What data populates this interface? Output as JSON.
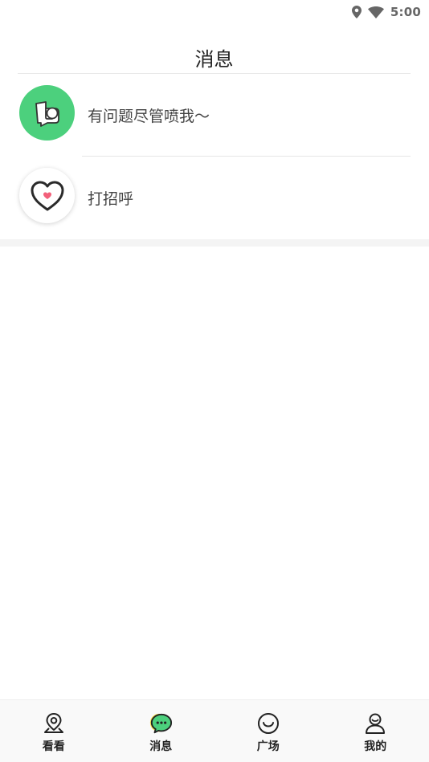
{
  "status_bar": {
    "time": "5:00",
    "icons": [
      "location-icon",
      "wifi-icon"
    ]
  },
  "header": {
    "title": "消息"
  },
  "conversations": [
    {
      "label": "有问题尽管喷我～",
      "icon": "feedback-icon",
      "avatar_color": "#4cd07d"
    },
    {
      "label": "打招呼",
      "icon": "heart-icon",
      "avatar_color": "#ffffff"
    }
  ],
  "tab_bar": {
    "tabs": [
      {
        "label": "看看",
        "icon": "map-pin-icon",
        "active": false
      },
      {
        "label": "消息",
        "icon": "chat-bubble-icon",
        "active": true
      },
      {
        "label": "广场",
        "icon": "smile-icon",
        "active": false
      },
      {
        "label": "我的",
        "icon": "profile-icon",
        "active": false
      }
    ]
  },
  "colors": {
    "accent_green": "#4cd07d",
    "accent_yellow": "#f7e14a",
    "heart_pink": "#f2607a"
  }
}
